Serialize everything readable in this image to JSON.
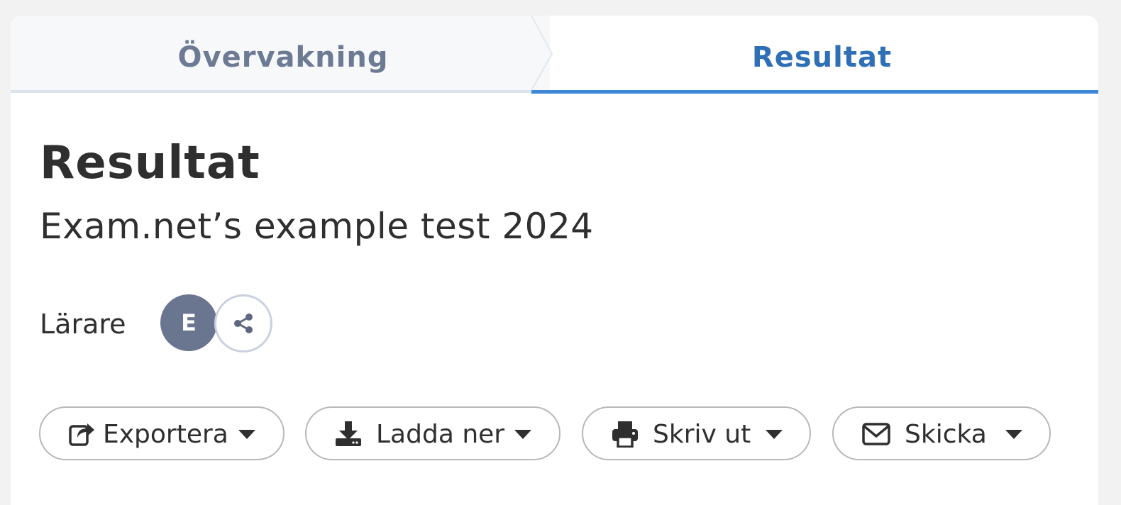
{
  "tabs": [
    {
      "label": "Övervakning",
      "active": false
    },
    {
      "label": "Resultat",
      "active": true
    }
  ],
  "header": {
    "title": "Resultat",
    "subtitle": "Exam.net’s example test 2024"
  },
  "teachers": {
    "label": "Lärare",
    "avatar_initial": "E",
    "share_icon": "share-icon"
  },
  "actions": [
    {
      "label": "Exportera",
      "icon": "export-icon"
    },
    {
      "label": "Ladda ner",
      "icon": "download-icon"
    },
    {
      "label": "Skriv ut",
      "icon": "print-icon"
    },
    {
      "label": "Skicka",
      "icon": "envelope-icon"
    }
  ],
  "colors": {
    "accent": "#3d86d8",
    "active_tab_text": "#2f6fb5",
    "inactive_tab_text": "#6c7a94",
    "avatar_bg": "#6a7590"
  }
}
